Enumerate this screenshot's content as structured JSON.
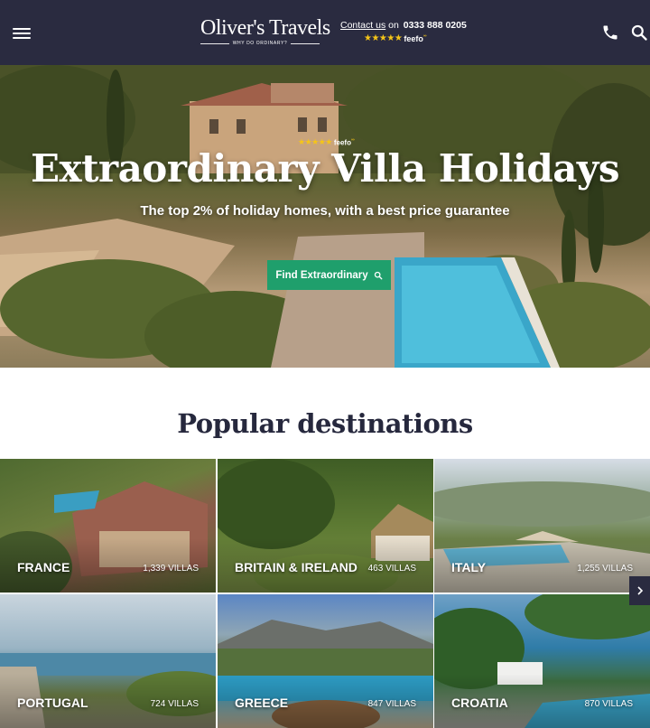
{
  "header": {
    "logo_text": "Oliver's Travels",
    "logo_tagline": "WHY DO ORDINARY?",
    "contact_label": "Contact us",
    "contact_on": "on",
    "phone": "0333 888 0205",
    "rating_stars": "★★★★★",
    "feefo": "feefo",
    "feefo_mark": "ºº",
    "icons": [
      "menu-icon",
      "phone-icon",
      "search-icon"
    ]
  },
  "hero": {
    "rating_stars": "★★★★★",
    "feefo": "feefo",
    "feefo_mark": "ºº",
    "title": "Extraordinary Villa Holidays",
    "subtitle": "The top 2% of holiday homes, with a best price guarantee",
    "cta_label": "Find Extraordinary"
  },
  "popular": {
    "title": "Popular destinations",
    "destinations": [
      {
        "name": "FRANCE",
        "count": "1,339 VILLAS"
      },
      {
        "name": "BRITAIN & IRELAND",
        "count": "463 VILLAS"
      },
      {
        "name": "ITALY",
        "count": "1,255 VILLAS"
      },
      {
        "name": "PORTUGAL",
        "count": "724 VILLAS"
      },
      {
        "name": "GREECE",
        "count": "847 VILLAS"
      },
      {
        "name": "CROATIA",
        "count": "870 VILLAS"
      }
    ]
  },
  "colors": {
    "header_bg": "#2a2b40",
    "cta_bg": "#1f9f6c",
    "chat_bg": "#1a6fc4",
    "heading": "#26283d",
    "star": "#f5c518"
  }
}
